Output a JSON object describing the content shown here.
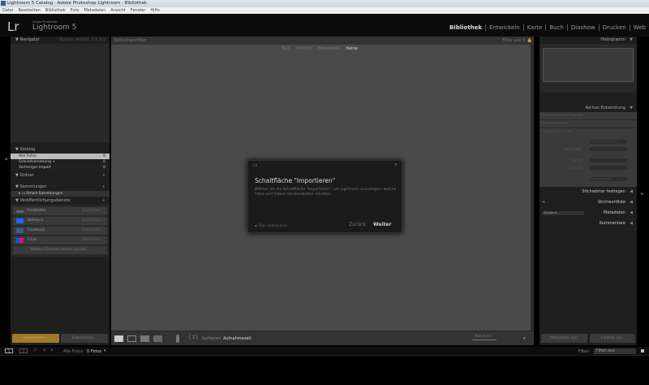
{
  "window": {
    "title": "Lightroom 5 Catalog - Adobe Photoshop Lightroom - Bibliothek"
  },
  "menu": [
    "Datei",
    "Bearbeiten",
    "Bibliothek",
    "Foto",
    "Metadaten",
    "Ansicht",
    "Fenster",
    "Hilfe"
  ],
  "brand": {
    "logo": "Lr",
    "line1": "Adobe Photoshop",
    "line2": "Lightroom 5"
  },
  "modules": [
    "Bibliothek",
    "Entwickeln",
    "Karte",
    "Buch",
    "Diashow",
    "Drucken",
    "Web"
  ],
  "left": {
    "navigator": {
      "title": "Navigator",
      "opts": [
        "Einpas.",
        "Ausfül.",
        "1:1",
        "3:1"
      ]
    },
    "catalog": {
      "title": "Katalog",
      "items": [
        {
          "label": "Alle Fotos",
          "count": "0"
        },
        {
          "label": "Schnellsammlung +",
          "count": "0"
        },
        {
          "label": "Vorheriger Import",
          "count": "0"
        }
      ]
    },
    "folders": {
      "title": "Ordner"
    },
    "collections": {
      "title": "Sammlungen",
      "items": [
        "Smart-Sammlungen"
      ]
    },
    "publish": {
      "title": "Veröffentlichungsdienste",
      "items": [
        {
          "label": "Festplatte",
          "action": "Einrichten..."
        },
        {
          "label": "Behance",
          "action": "Einrichten..."
        },
        {
          "label": "Facebook",
          "action": "Einrichten..."
        },
        {
          "label": "Flickr",
          "action": "Einrichten..."
        }
      ],
      "more": "Weitere Dienste online suchen..."
    },
    "import": "Importieren...",
    "export": "Exportieren...",
    "plus": "+"
  },
  "filterbar": {
    "title": "Bibliotheksfilter:",
    "tabs": [
      "Text",
      "Attribut",
      "Metadaten",
      "Keine"
    ],
    "preset": "Filter aus ⇕"
  },
  "dialog": {
    "step": "1/8",
    "close": "×",
    "title": "Schaltfläche \"Importieren\"",
    "body": "Wählen Sie die Schaltfläche \"Importieren\", um Lightroom anzuzeigen, welche Fotos und Videos Sie bearbeiten möchten.",
    "disable": "Tipps deaktivieren",
    "back": "Zurück",
    "next": "Weiter"
  },
  "toolbar": {
    "sort_label": "Sortieren:",
    "sort_value": "Aufnahmezeit",
    "thumb_label": "Miniaturen"
  },
  "right": {
    "histogram": "Histogramm",
    "quick": {
      "title": "Ad-hoc-Entwicklung",
      "rows": [
        "Gespeicherte Vorgabe",
        "Weißabgleich",
        "Tonwertkontrolle"
      ],
      "auto": "Automatischer Tonwert",
      "exposure": "Belichtung",
      "clarity": "Klarheit",
      "vibrance": "Dynamik",
      "reset": "Alles zurücksetzen"
    },
    "keywording": "Stichwörter festlegen",
    "keywordlist": "Stichwortliste",
    "metadata": "Metadaten",
    "metadata_preset": "Standard",
    "comments": "Kommentare",
    "sync_meta": "Metadaten syn.",
    "sync_settings": "Einstell. syn."
  },
  "filmstrip": {
    "pages": [
      "1",
      "2"
    ],
    "source": "Alle Fotos",
    "count": "0 Fotos",
    "filter_label": "Filter:",
    "filter_value": "Filter aus"
  }
}
